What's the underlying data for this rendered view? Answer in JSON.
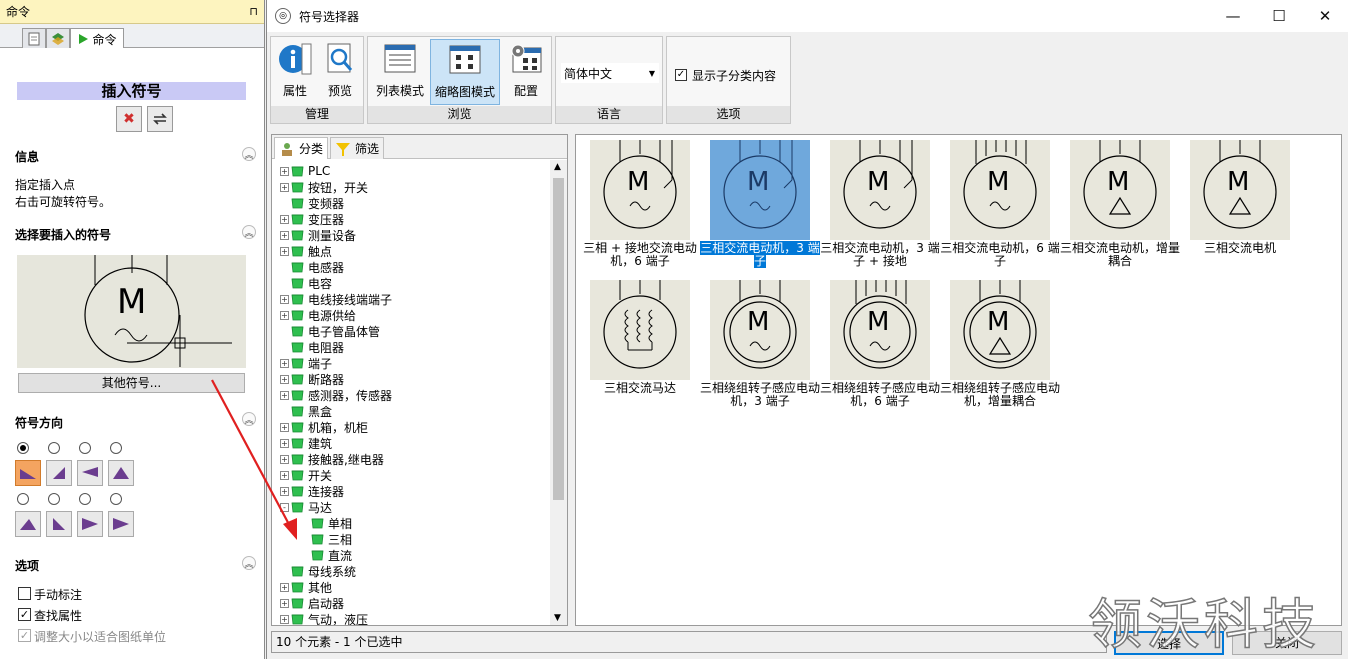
{
  "left_panel": {
    "title": "命令",
    "pin": "⊓",
    "tabs": [
      {
        "label": ""
      },
      {
        "label": ""
      },
      {
        "label": "命令"
      }
    ],
    "insert_title": "插入符号",
    "info": {
      "heading": "信息",
      "line1": "指定插入点",
      "line2": "右击可旋转符号。"
    },
    "select_heading": "选择要插入的符号",
    "other_symbols": "其他符号...",
    "direction_heading": "符号方向",
    "options_heading": "选项",
    "options": [
      {
        "label": "手动标注",
        "checked": false,
        "disabled": false
      },
      {
        "label": "查找属性",
        "checked": true,
        "disabled": false
      },
      {
        "label": "调整大小以适合图纸单位",
        "checked": true,
        "disabled": true
      }
    ]
  },
  "window": {
    "title": "符号选择器",
    "ribbon": {
      "groups": [
        {
          "label": "管理",
          "buttons": [
            "属性",
            "预览"
          ]
        },
        {
          "label": "浏览",
          "buttons": [
            "列表模式",
            "缩略图模式",
            "配置"
          ]
        },
        {
          "label": "语言",
          "select": "简体中文"
        },
        {
          "label": "选项",
          "checkbox": "显示子分类内容"
        }
      ]
    },
    "tree_tabs": [
      "分类",
      "筛选"
    ],
    "tree": [
      {
        "label": "PLC",
        "exp": "+",
        "depth": 0
      },
      {
        "label": "按钮，开关",
        "exp": "+",
        "depth": 0
      },
      {
        "label": "变频器",
        "exp": "",
        "depth": 0
      },
      {
        "label": "变压器",
        "exp": "+",
        "depth": 0
      },
      {
        "label": "测量设备",
        "exp": "+",
        "depth": 0
      },
      {
        "label": "触点",
        "exp": "+",
        "depth": 0
      },
      {
        "label": "电感器",
        "exp": "",
        "depth": 0
      },
      {
        "label": "电容",
        "exp": "",
        "depth": 0
      },
      {
        "label": "电线接线端端子",
        "exp": "+",
        "depth": 0
      },
      {
        "label": "电源供给",
        "exp": "+",
        "depth": 0
      },
      {
        "label": "电子管晶体管",
        "exp": "",
        "depth": 0
      },
      {
        "label": "电阻器",
        "exp": "",
        "depth": 0
      },
      {
        "label": "端子",
        "exp": "+",
        "depth": 0
      },
      {
        "label": "断路器",
        "exp": "+",
        "depth": 0
      },
      {
        "label": "感测器，传感器",
        "exp": "+",
        "depth": 0
      },
      {
        "label": "黑盒",
        "exp": "",
        "depth": 0
      },
      {
        "label": "机箱，机柜",
        "exp": "+",
        "depth": 0
      },
      {
        "label": "建筑",
        "exp": "+",
        "depth": 0
      },
      {
        "label": "接触器,继电器",
        "exp": "+",
        "depth": 0
      },
      {
        "label": "开关",
        "exp": "+",
        "depth": 0
      },
      {
        "label": "连接器",
        "exp": "+",
        "depth": 0
      },
      {
        "label": "马达",
        "exp": "-",
        "depth": 0
      },
      {
        "label": "单相",
        "exp": "",
        "depth": 1
      },
      {
        "label": "三相",
        "exp": "",
        "depth": 1
      },
      {
        "label": "直流",
        "exp": "",
        "depth": 1
      },
      {
        "label": "母线系统",
        "exp": "",
        "depth": 0
      },
      {
        "label": "其他",
        "exp": "+",
        "depth": 0
      },
      {
        "label": "启动器",
        "exp": "+",
        "depth": 0
      },
      {
        "label": "气动，液压",
        "exp": "+",
        "depth": 0
      }
    ],
    "tiles": [
      {
        "caption": "三相 + 接地交流电动机，6 端子",
        "kind": "m_tilde_wires3",
        "selected": false
      },
      {
        "caption": "三相交流电动机，3 端子",
        "kind": "m_tilde_wires3",
        "selected": true
      },
      {
        "caption": "三相交流电动机，3 端子 + 接地",
        "kind": "m_tilde_wires3",
        "selected": false
      },
      {
        "caption": "三相交流电动机，6 端子",
        "kind": "m_tilde_wires6",
        "selected": false
      },
      {
        "caption": "三相交流电动机，增量耦合",
        "kind": "m_triangle",
        "selected": false
      },
      {
        "caption": "三相交流电机",
        "kind": "m_triangle",
        "selected": false
      },
      {
        "caption": "三相交流马达",
        "kind": "coils",
        "selected": false
      },
      {
        "caption": "三相绕组转子感应电动机，3 端子",
        "kind": "double_tilde",
        "selected": false
      },
      {
        "caption": "三相绕组转子感应电动机，6 端子",
        "kind": "double_tilde6",
        "selected": false
      },
      {
        "caption": "三相绕组转子感应电动机，增量耦合",
        "kind": "double_triangle",
        "selected": false
      }
    ],
    "status": "10 个元素 - 1 个已选中",
    "select_button": "选择",
    "close_button": "关闭"
  },
  "watermark": "领沃科技",
  "colors": {
    "accent": "#0078d7",
    "title_highlight": "#c9c9f5",
    "arrow": "#e02020"
  }
}
